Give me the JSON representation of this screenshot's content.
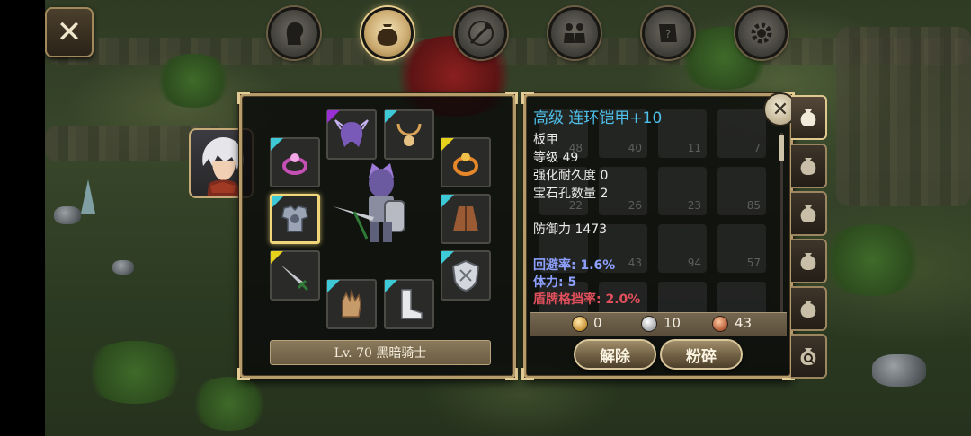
{
  "top_bar": {
    "close_label": "✕",
    "tabs": [
      {
        "name": "character",
        "icon": "head-icon"
      },
      {
        "name": "inventory",
        "icon": "bag-icon",
        "active": true
      },
      {
        "name": "skills",
        "icon": "sword-compass-icon"
      },
      {
        "name": "party",
        "icon": "people-icon"
      },
      {
        "name": "quest",
        "icon": "scroll-icon"
      },
      {
        "name": "settings",
        "icon": "gear-icon"
      }
    ]
  },
  "equipment": {
    "level_label": "Lv. 70 黑暗骑士",
    "slots": [
      {
        "id": "helmet",
        "rarity": "purple"
      },
      {
        "id": "necklace",
        "rarity": "cyan"
      },
      {
        "id": "ring",
        "rarity": "cyan"
      },
      {
        "id": "amulet",
        "rarity": "yellow"
      },
      {
        "id": "armor",
        "rarity": "cyan",
        "selected": true
      },
      {
        "id": "cloak",
        "rarity": "cyan"
      },
      {
        "id": "weapon",
        "rarity": "yellow"
      },
      {
        "id": "shield",
        "rarity": "cyan"
      },
      {
        "id": "gloves",
        "rarity": "cyan"
      },
      {
        "id": "boots",
        "rarity": "cyan"
      }
    ]
  },
  "item_info": {
    "title": "高级 连环铠甲+10",
    "type": "板甲",
    "level": "等级 49",
    "durability": "强化耐久度 0",
    "gem_slots": "宝石孔数量 2",
    "defense": "防御力 1473",
    "dodge": "回避率: 1.6%",
    "stamina": "体力: 5",
    "block": "盾牌格挡率: 2.0%"
  },
  "bag_counts": [
    "48",
    "40",
    "11",
    "7",
    "22",
    "26",
    "23",
    "85",
    "",
    "43",
    "94",
    "57"
  ],
  "currency": {
    "gold": "0",
    "silver": "10",
    "copper": "43"
  },
  "actions": {
    "unequip": "解除",
    "smash": "粉碎"
  },
  "close_panel_label": "✕",
  "side_tabs": [
    "bag-icon",
    "bag-icon",
    "bag-icon",
    "bag-icon",
    "bag-icon",
    "bag-search-icon"
  ]
}
